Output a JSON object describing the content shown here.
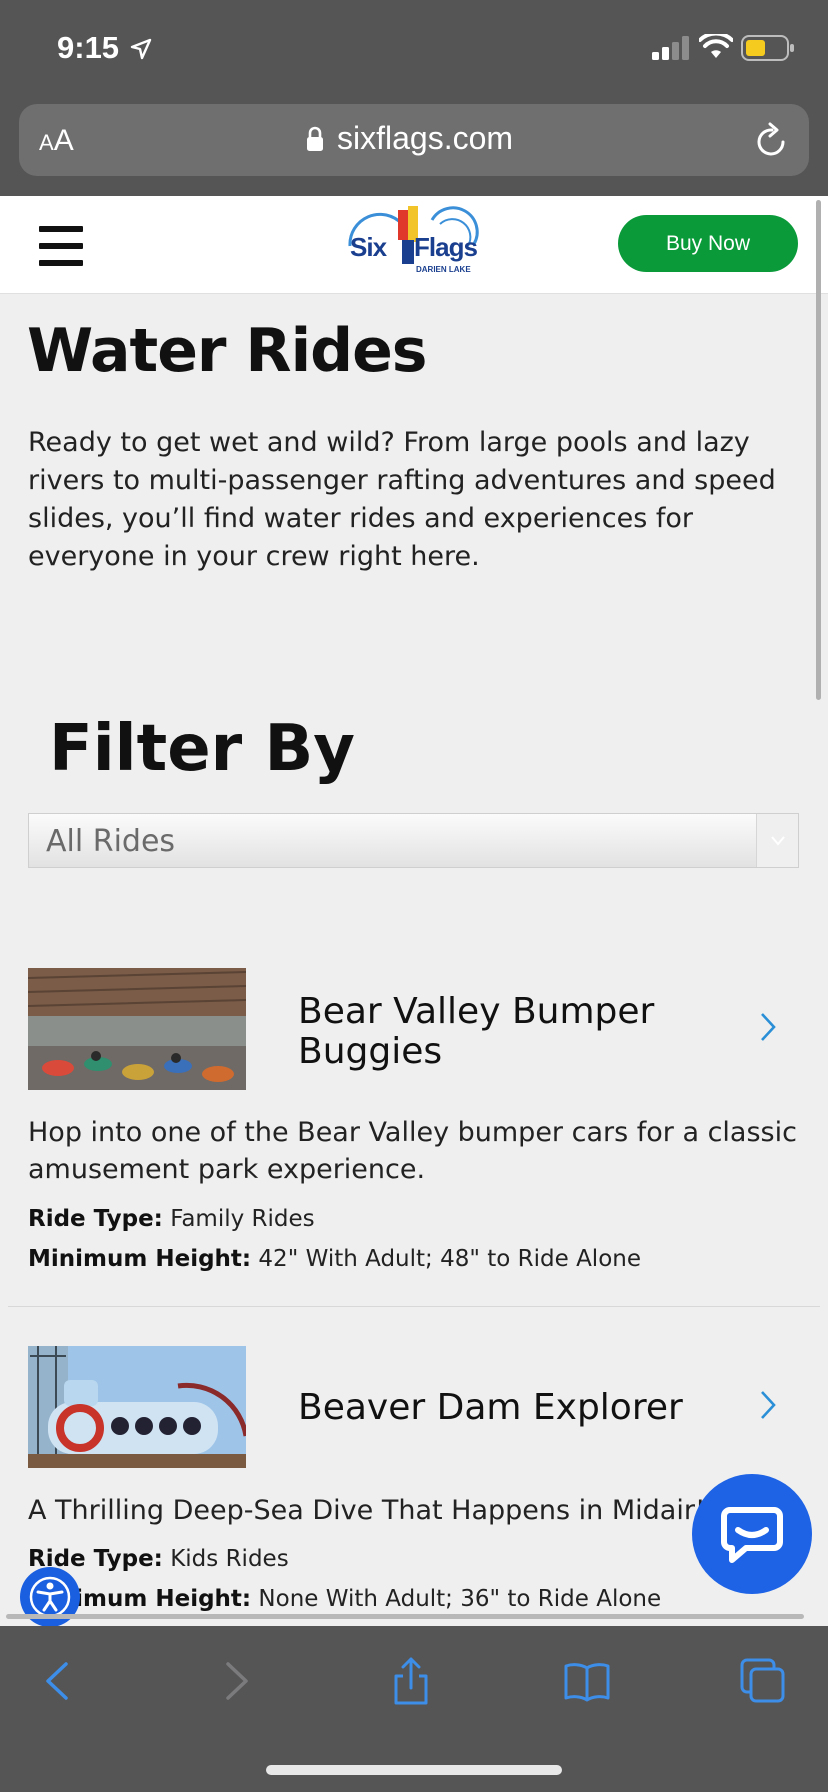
{
  "status_bar": {
    "time": "9:15"
  },
  "browser": {
    "text_size_label_small": "A",
    "text_size_label_large": "A",
    "url": "sixflags.com"
  },
  "header": {
    "logo_text": "Six Flags",
    "logo_subtext": "DARIEN LAKE",
    "buy_button": "Buy Now"
  },
  "page": {
    "title": "Water Rides",
    "intro": "Ready to get wet and wild? From large pools and lazy rivers to multi-passenger rafting adventures and speed slides, you’ll find water rides and experiences for everyone in your crew right here."
  },
  "filter": {
    "heading": "Filter By",
    "selected": "All Rides"
  },
  "rides": [
    {
      "name": "Bear Valley Bumper Buggies",
      "description": "Hop into one of the Bear Valley bumper cars for a classic amusement park experience.",
      "ride_type_label": "Ride Type:",
      "ride_type": "Family Rides",
      "min_height_label": "Minimum Height:",
      "min_height": "42\" With Adult; 48\" to Ride Alone"
    },
    {
      "name": "Beaver Dam Explorer",
      "description": "A Thrilling Deep-Sea Dive That Happens in Midair!",
      "ride_type_label": "Ride Type:",
      "ride_type": "Kids Rides",
      "min_height_label": "Minimum Height:",
      "min_height": "None With Adult; 36\" to Ride Alone"
    }
  ],
  "icons": {
    "chat": "chat-bubble-icon",
    "accessibility": "accessibility-icon",
    "toolbar": [
      "back-icon",
      "forward-icon",
      "share-icon",
      "bookmarks-icon",
      "tabs-icon"
    ]
  },
  "colors": {
    "buy_button": "#0a9a3a",
    "chat_button": "#1e63e6",
    "link_chevron": "#2a8fd6"
  }
}
